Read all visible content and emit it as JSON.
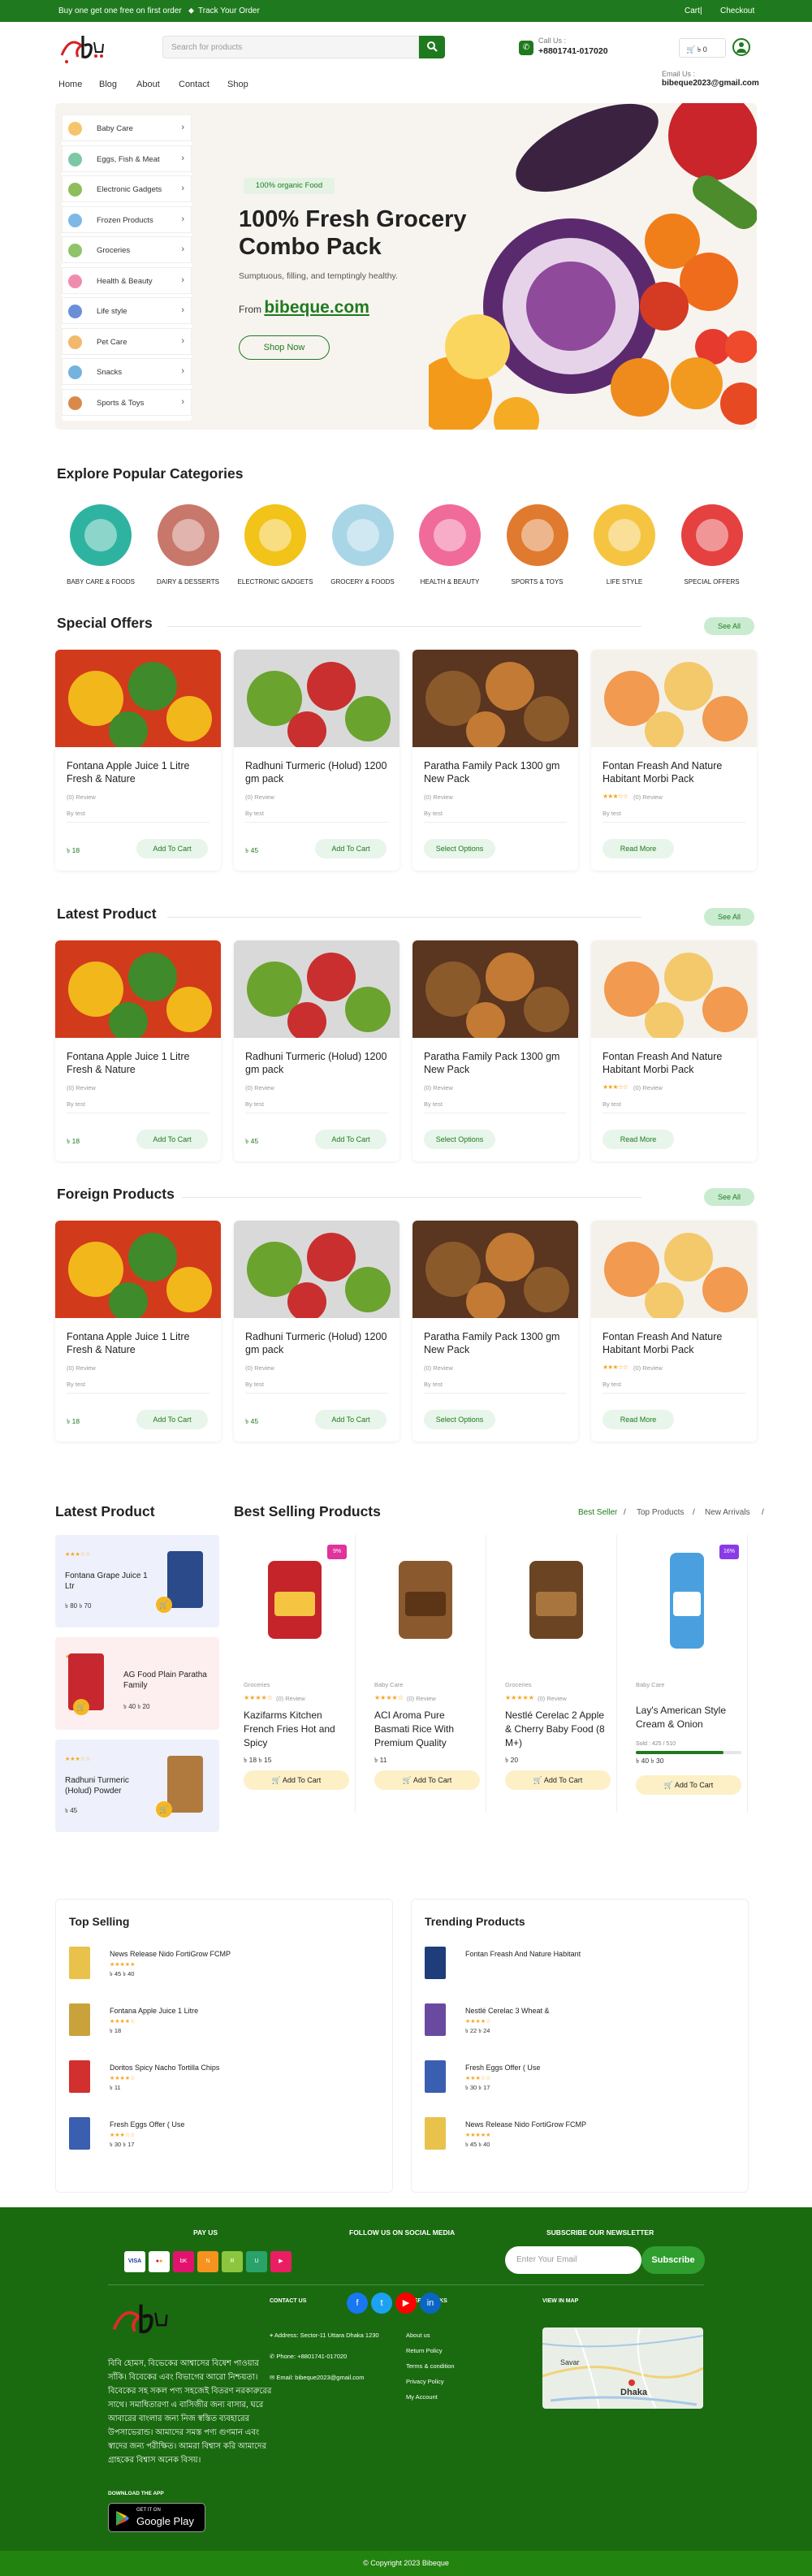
{
  "topbar": {
    "promo": "Buy one get one free on first order",
    "track": "Track Your Order",
    "cart": "Cart",
    "checkout": "Checkout"
  },
  "header": {
    "search_placeholder": "Search for products",
    "call_label": "Call Us :",
    "phone": "+8801741-017020",
    "cart_amount": "৳ 0",
    "email_label": "Email Us :",
    "email": "bibeque2023@gmail.com"
  },
  "nav": [
    "Home",
    "Blog",
    "About",
    "Contact",
    "Shop"
  ],
  "sidebar": {
    "items": [
      {
        "label": "Baby Care",
        "icon": "baby-icon",
        "color": "#f5c56b"
      },
      {
        "label": "Eggs, Fish & Meat",
        "icon": "egg-icon",
        "color": "#7cc7a4"
      },
      {
        "label": "Electronic Gadgets",
        "icon": "gadget-icon",
        "color": "#8fbd5b"
      },
      {
        "label": "Frozen Products",
        "icon": "frozen-icon",
        "color": "#7fb8e6"
      },
      {
        "label": "Groceries",
        "icon": "grocery-icon",
        "color": "#8fc46a"
      },
      {
        "label": "Health & Beauty",
        "icon": "beauty-icon",
        "color": "#f08cae"
      },
      {
        "label": "Life style",
        "icon": "lifestyle-icon",
        "color": "#6a8fd8"
      },
      {
        "label": "Pet Care",
        "icon": "pet-icon",
        "color": "#f3b86a"
      },
      {
        "label": "Snacks",
        "icon": "snack-icon",
        "color": "#74b2e0"
      },
      {
        "label": "Sports & Toys",
        "icon": "sports-icon",
        "color": "#d9894a"
      }
    ]
  },
  "hero": {
    "badge": "100% organic Food",
    "title_line1": "100% Fresh Grocery",
    "title_line2": "Combo Pack",
    "subtitle": "Sumptuous, filling, and temptingly healthy.",
    "from": "From",
    "brand": "bibeque.com",
    "cta": "Shop Now"
  },
  "popular": {
    "title": "Explore Popular Categories",
    "items": [
      {
        "label": "BABY CARE & FOODS",
        "color": "#2fb3a1"
      },
      {
        "label": "DAIRY & DESSERTS",
        "color": "#c8776b"
      },
      {
        "label": "ELECTRONIC GADGETS",
        "color": "#f2c318"
      },
      {
        "label": "GROCERY & FOODS",
        "color": "#a9d6e6"
      },
      {
        "label": "HEALTH & BEAUTY",
        "color": "#f06b9a"
      },
      {
        "label": "SPORTS & TOYS",
        "color": "#e07a2e"
      },
      {
        "label": "LIFE STYLE",
        "color": "#f5c542"
      },
      {
        "label": "SPECIAL OFFERS",
        "color": "#e54141"
      }
    ]
  },
  "sections": [
    {
      "title": "Special Offers",
      "see_all": "See All",
      "products": [
        {
          "name": "Fontana Apple Juice 1 Litre Fresh & Nature",
          "review": "(0) Review",
          "by": "By test",
          "price": "৳ 18",
          "btn": "Add To Cart",
          "stars": ""
        },
        {
          "name": "Radhuni Turmeric (Holud) 1200 gm pack",
          "review": "(0) Review",
          "by": "By test",
          "price": "৳ 45",
          "btn": "Add To Cart",
          "stars": ""
        },
        {
          "name": "Paratha Family Pack 1300 gm New Pack",
          "review": "(0) Review",
          "by": "By test",
          "price": "",
          "btn": "Select Options",
          "stars": ""
        },
        {
          "name": "Fontan Freash And Nature Habitant Morbi Pack",
          "review": "(0) Review",
          "by": "By test",
          "price": "",
          "btn": "Read More",
          "stars": "★★★☆☆"
        }
      ]
    },
    {
      "title": "Latest Product",
      "see_all": "See All",
      "products": [
        {
          "name": "Fontana Apple Juice 1 Litre Fresh & Nature",
          "review": "(0) Review",
          "by": "By test",
          "price": "৳ 18",
          "btn": "Add To Cart",
          "stars": ""
        },
        {
          "name": "Radhuni Turmeric (Holud) 1200 gm pack",
          "review": "(0) Review",
          "by": "By test",
          "price": "৳ 45",
          "btn": "Add To Cart",
          "stars": ""
        },
        {
          "name": "Paratha Family Pack 1300 gm New Pack",
          "review": "(0) Review",
          "by": "By test",
          "price": "",
          "btn": "Select Options",
          "stars": ""
        },
        {
          "name": "Fontan Freash And Nature Habitant Morbi Pack",
          "review": "(0) Review",
          "by": "By test",
          "price": "",
          "btn": "Read More",
          "stars": "★★★☆☆"
        }
      ]
    },
    {
      "title": "Foreign Products",
      "see_all": "See All",
      "products": [
        {
          "name": "Fontana Apple Juice 1 Litre Fresh & Nature",
          "review": "(0) Review",
          "by": "By test",
          "price": "৳ 18",
          "btn": "Add To Cart",
          "stars": ""
        },
        {
          "name": "Radhuni Turmeric (Holud) 1200 gm pack",
          "review": "(0) Review",
          "by": "By test",
          "price": "৳ 45",
          "btn": "Add To Cart",
          "stars": ""
        },
        {
          "name": "Paratha Family Pack 1300 gm New Pack",
          "review": "(0) Review",
          "by": "By test",
          "price": "",
          "btn": "Select Options",
          "stars": ""
        },
        {
          "name": "Fontan Freash And Nature Habitant Morbi Pack",
          "review": "(0) Review",
          "by": "By test",
          "price": "",
          "btn": "Read More",
          "stars": "★★★☆☆"
        }
      ]
    }
  ],
  "latest_side": {
    "title": "Latest Product",
    "items": [
      {
        "name": "Fontana Grape Juice 1 Ltr",
        "stars": "★★★☆☆",
        "price": "৳ 80  ৳ 70",
        "bg": "#eef1fb"
      },
      {
        "name": "AG Food Plain Paratha Family",
        "stars": "★★★★★",
        "price": "৳ 40  ৳ 20",
        "bg": "#fdeef0"
      },
      {
        "name": "Radhuni Turmeric (Holud) Powder",
        "stars": "★★★☆☆",
        "price": "৳ 45",
        "bg": "#eef1fb"
      }
    ]
  },
  "best_selling": {
    "title": "Best Selling Products",
    "tabs": [
      "Best Seller",
      "Top Products",
      "New Arrivals"
    ],
    "items": [
      {
        "category": "Groceries",
        "stars": "★★★★☆",
        "review": "(0) Review",
        "name": "Kazifarms Kitchen French Fries Hot and Spicy",
        "price": "৳ 18  ৳ 15",
        "btn": "Add To Cart",
        "badge": "9%"
      },
      {
        "category": "Baby Care",
        "stars": "★★★★☆",
        "review": "(0) Review",
        "name": "ACI Aroma Pure Basmati Rice With Premium Quality",
        "price": "৳ 11",
        "btn": "Add To Cart",
        "badge": ""
      },
      {
        "category": "Groceries",
        "stars": "★★★★★",
        "review": "(0) Review",
        "name": "Nestlé Cerelac 2 Apple & Cherry Baby Food (8 M+)",
        "price": "৳ 20",
        "btn": "Add To Cart",
        "badge": ""
      },
      {
        "category": "Baby Care",
        "stars": "",
        "review": "",
        "name": "Lay's American Style Cream & Onion",
        "price": "৳ 40  ৳ 30",
        "sold": "Sold : 425 / 510",
        "sold_fraction": 0.83,
        "btn": "Add To Cart",
        "badge": "16%"
      }
    ]
  },
  "top_selling": {
    "title": "Top Selling",
    "items": [
      {
        "name": "News Release Nido FortiGrow FCMP",
        "stars": "★★★★★",
        "price": "৳ 45  ৳ 40"
      },
      {
        "name": "Fontana Apple Juice 1 Litre",
        "stars": "★★★★☆",
        "price": "৳ 18"
      },
      {
        "name": "Doritos Spicy Nacho Tortilla Chips",
        "stars": "★★★★☆",
        "price": "৳ 11"
      },
      {
        "name": "Fresh Eggs Offer ( Use",
        "stars": "★★★☆☆",
        "price": "৳ 30  ৳ 17"
      }
    ]
  },
  "trending": {
    "title": "Trending Products",
    "items": [
      {
        "name": "Fontan Freash And Nature Habitant",
        "stars": "",
        "price": ""
      },
      {
        "name": "Nestlé Cerelac 3 Wheat &",
        "stars": "★★★★☆",
        "price": "৳ 22  ৳ 24"
      },
      {
        "name": "Fresh Eggs Offer ( Use",
        "stars": "★★★☆☆",
        "price": "৳ 30  ৳ 17"
      },
      {
        "name": "News Release Nido FortiGrow FCMP",
        "stars": "★★★★★",
        "price": "৳ 45  ৳ 40"
      }
    ]
  },
  "footer": {
    "pay_us": "PAY US",
    "follow": "FOLLOW US ON SOCIAL MEDIA",
    "newsletter": "SUBSCRIBE OUR NEWSLETTER",
    "email_placeholder": "Enter Your Email",
    "subscribe": "Subscribe",
    "contact_title": "CONTACT US",
    "address": "Address: Sector-11 Uttara Dhaka 1230",
    "phone": "Phone: +8801741-017020",
    "email": "Email: bibeque2023@gmail.com",
    "useful_title": "USEFUL LINKS",
    "links": [
      "About us",
      "Return Policy",
      "Terms & condition",
      "Privacy Policy",
      "My Account"
    ],
    "map_title": "VIEW IN MAP",
    "map_labels": [
      "Savar",
      "Dhaka"
    ],
    "about_text": "বিবি হোমস, বিভেকের আশ্বাসের বিষেশ পাওয়ার সাঁকি। বিবেকের এবং বিভাগের আরো নিশ্চয়তা। বিবেকের সহ সকল পণ্য সহজেই বিতরণ নরকারুরের সাথে। সমাধিতারণা এ বাসিজীর জন্য বাসার, ঘরে আবারের বাংলার জন্য নিজ স্বস্তিত ব্যবহারের উপসাভেরান্ড। আমাদের সমস্ত পণ্য গুণমান এবং স্বাদের জন্য পরীক্ষিত। আমরা বিশ্বাস করি আমাদের গ্রাহকের বিশ্বাস অনেক বিসয়।",
    "download": "DOWNLOAD THE APP",
    "get_it_on": "GET IT ON",
    "store": "Google Play",
    "copyright": "© Copyright 2023 Bibeque"
  }
}
